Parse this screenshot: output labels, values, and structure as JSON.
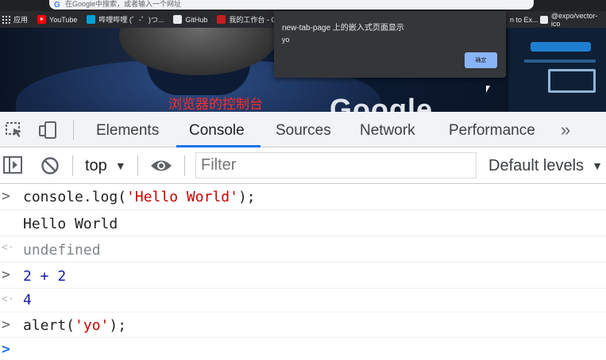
{
  "browser": {
    "omnibox_text": "在Google中搜索，或者输入一个网址",
    "bookmarks": [
      {
        "label": "应用",
        "icon": "apps-icon"
      },
      {
        "label": "YouTube",
        "icon": "youtube-icon"
      },
      {
        "label": "哔哩哔哩 (゜-゜)つ...",
        "icon": "bilibili-icon"
      },
      {
        "label": "GitHub",
        "icon": "github-icon"
      },
      {
        "label": "我的工作台 - Gitee...",
        "icon": "gitee-icon"
      }
    ],
    "bookmarks_right": [
      {
        "label": "n to Ex..."
      },
      {
        "label": "@expo/vector-ico",
        "icon": "extension-icon"
      }
    ]
  },
  "page": {
    "caption": "浏览器的控制台",
    "logo_text": "Google"
  },
  "alert": {
    "title": "new-tab-page 上的嵌入式页面显示",
    "message": "yo",
    "ok_label": "确定"
  },
  "devtools": {
    "tabs": [
      {
        "label": "Elements",
        "active": false
      },
      {
        "label": "Console",
        "active": true
      },
      {
        "label": "Sources",
        "active": false
      },
      {
        "label": "Network",
        "active": false
      },
      {
        "label": "Performance",
        "active": false
      }
    ],
    "more_tabs": "»",
    "toolbar": {
      "context": "top",
      "filter_placeholder": "Filter",
      "levels": "Default levels"
    },
    "colors": {
      "accent": "#1a73e8",
      "string": "#c80000",
      "number": "#1a1aa6"
    }
  },
  "console": {
    "lines": [
      {
        "type": "input",
        "glyph": ">",
        "parts": [
          "console.log(",
          "'Hello World'",
          ");"
        ]
      },
      {
        "type": "log",
        "glyph": "",
        "text": "Hello World"
      },
      {
        "type": "result",
        "glyph": "<·",
        "text": "undefined"
      },
      {
        "type": "input",
        "glyph": ">",
        "text": "2 + 2"
      },
      {
        "type": "result",
        "glyph": "<·",
        "text": "4"
      },
      {
        "type": "input",
        "glyph": ">",
        "parts": [
          "alert(",
          "'yo'",
          ");"
        ]
      },
      {
        "type": "prompt",
        "glyph": ">",
        "text": ""
      }
    ]
  }
}
